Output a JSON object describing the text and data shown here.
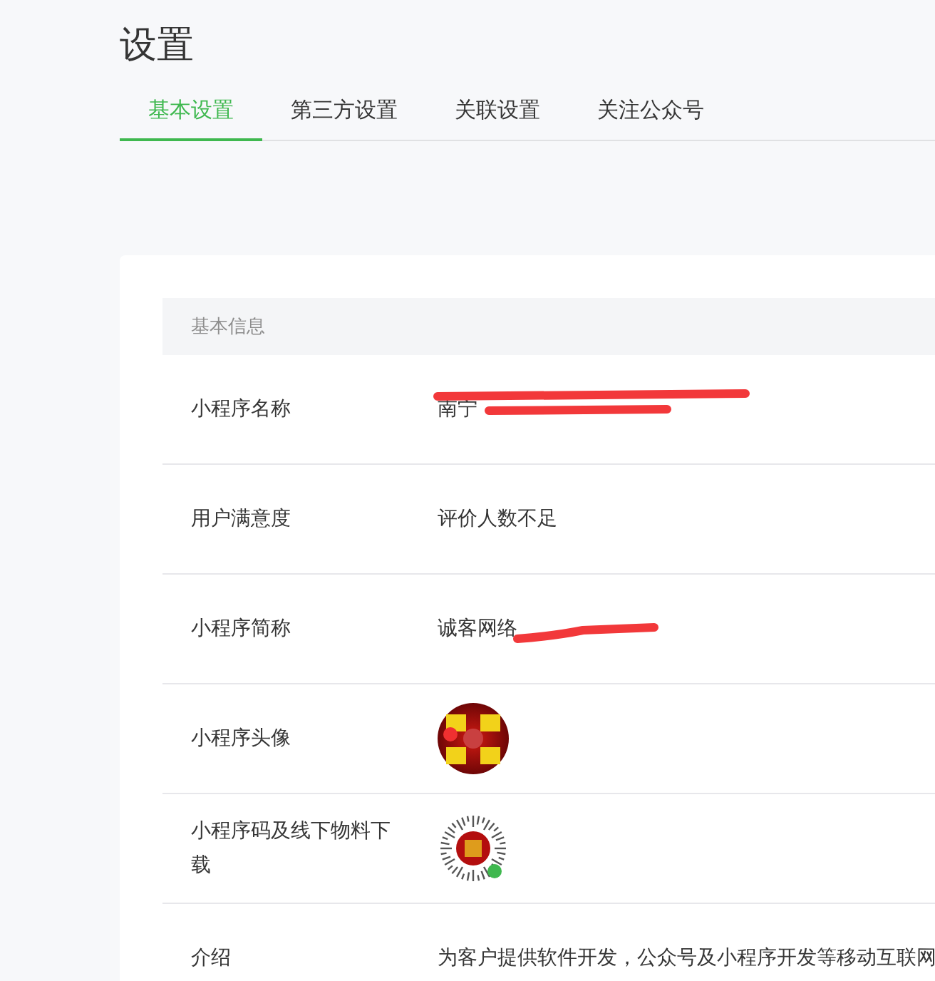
{
  "page_title": "设置",
  "tabs": [
    {
      "label": "基本设置",
      "selected": true
    },
    {
      "label": "第三方设置",
      "selected": false
    },
    {
      "label": "关联设置",
      "selected": false
    },
    {
      "label": "关注公众号",
      "selected": false
    }
  ],
  "section": {
    "title": "基本信息",
    "rows": [
      {
        "label": "小程序名称",
        "kind": "text",
        "value": "南宁",
        "redacted": true
      },
      {
        "label": "用户满意度",
        "kind": "text",
        "value": "评价人数不足",
        "redacted": false
      },
      {
        "label": "小程序简称",
        "kind": "text",
        "value": "诚客网络",
        "redacted": true
      },
      {
        "label": "小程序头像",
        "kind": "avatar"
      },
      {
        "label": "小程序码及线下物料下载",
        "kind": "qrcode"
      },
      {
        "label": "介绍",
        "kind": "text",
        "value": "为客户提供软件开发，公众号及小程序开发等移动互联网",
        "redacted": false
      }
    ]
  }
}
